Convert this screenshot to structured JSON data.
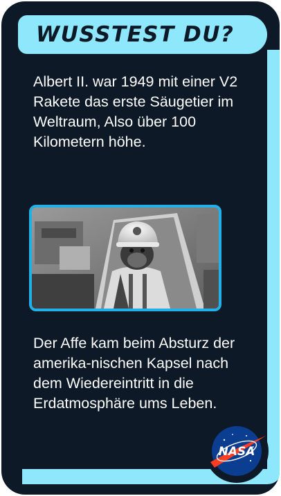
{
  "card": {
    "title": "WUSSTEST DU?",
    "paragraph1": "Albert II. war 1949 mit einer V2 Rakete das erste Säugetier im Weltraum, Also über 100 Kilometern höhe.",
    "paragraph2": "Der Affe kam beim Absturz der amerika-nischen Kapsel nach dem Wiedereintritt in die Erdatmosphäre ums Leben.",
    "photo_icon": "astronaut-monkey-photo",
    "logo": {
      "name": "nasa-logo",
      "text": "NASA"
    }
  },
  "colors": {
    "background": "#0d1926",
    "accent": "#8ee7fb",
    "photo_border": "#22b0e8",
    "text": "#ffffff",
    "nasa_blue": "#0b3d91",
    "nasa_red": "#fc3d21"
  }
}
